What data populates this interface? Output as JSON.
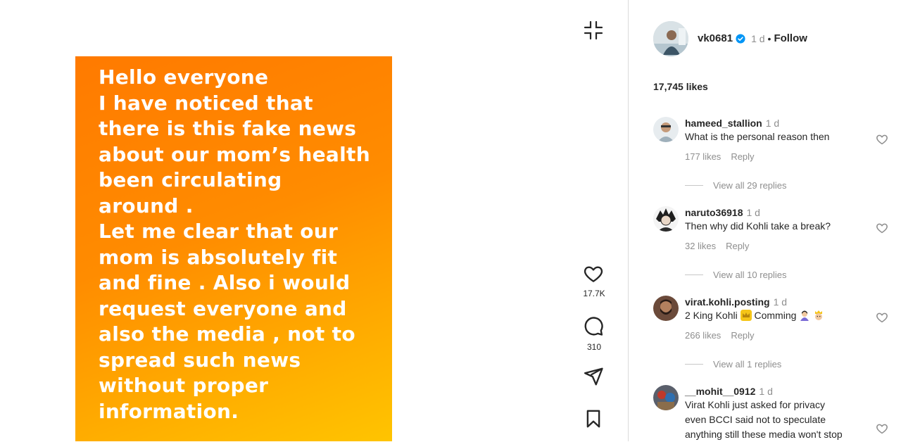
{
  "story": {
    "lines": [
      "Hello everyone",
      "I have noticed that",
      "there is this fake news",
      "about our mom’s health",
      "been circulating",
      "around .",
      "Let me clear that our",
      "mom is absolutely fit",
      "and fine . Also i would",
      "request everyone and",
      "also the media , not to",
      "spread such news",
      "without proper",
      "information."
    ]
  },
  "actions": {
    "like_count": "17.7K",
    "comment_count": "310"
  },
  "post": {
    "author": "vk0681",
    "time": "1 d",
    "separator": "•",
    "follow_label": "Follow",
    "likes": "17,745 likes"
  },
  "comments": [
    {
      "user": "hameed_stallion",
      "time": "1 d",
      "text": "What is the personal reason then",
      "likes": "177 likes",
      "reply": "Reply",
      "view_replies": "View all 29 replies"
    },
    {
      "user": "naruto36918",
      "time": "1 d",
      "text": "Then why did Kohli take a break?",
      "likes": "32 likes",
      "reply": "Reply",
      "view_replies": "View all 10 replies"
    },
    {
      "user": "virat.kohli.posting",
      "time": "1 d",
      "text_before": "2 King Kohli",
      "text_after": "Comming",
      "likes": "266 likes",
      "reply": "Reply",
      "view_replies": "View all 1 replies"
    },
    {
      "user": "__mohit__0912",
      "time": "1 d",
      "lines": [
        "Virat Kohli just asked for privacy",
        "even BCCI said not to speculate",
        "anything still these media won't stop"
      ]
    }
  ],
  "icons": {
    "collapse": "collapse-icon",
    "like": "heart-icon",
    "comment": "comment-icon",
    "share": "send-icon",
    "save": "bookmark-icon",
    "verified": "verified-badge-icon",
    "crown": "crown-emoji-icon",
    "praying_person": "person-emoji-icon",
    "king_face": "king-face-emoji-icon"
  },
  "colors": {
    "story_gradient_start": "#ff7a00",
    "story_gradient_end": "#ffc400",
    "verified_blue": "#0095f6",
    "secondary_text": "#8e8e8e"
  }
}
